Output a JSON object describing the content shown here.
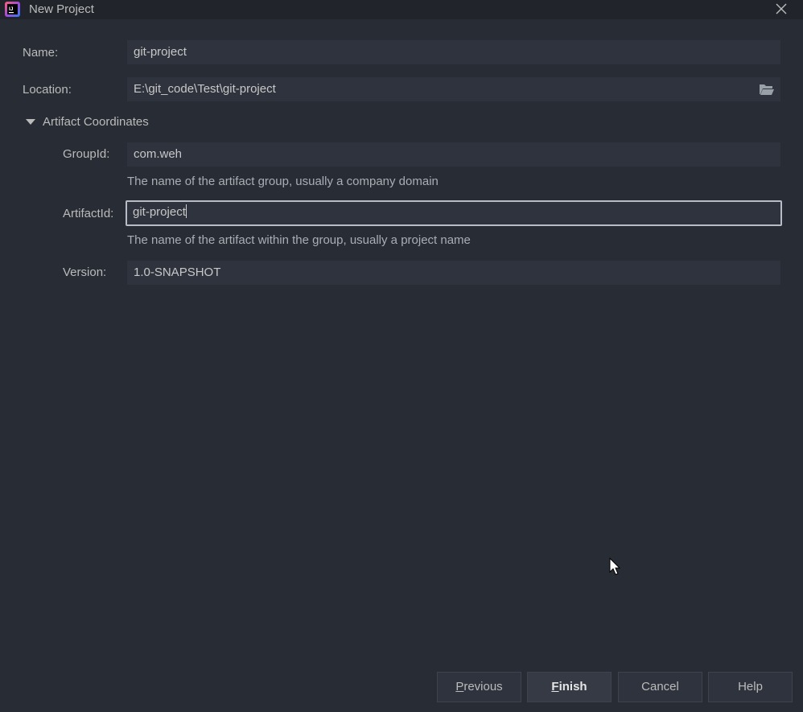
{
  "window": {
    "title": "New Project",
    "icon": "intellij-idea-icon"
  },
  "form": {
    "name": {
      "label": "Name:",
      "value": "git-project"
    },
    "location": {
      "label": "Location:",
      "value": "E:\\git_code\\Test\\git-project",
      "browse_icon": "folder-open-icon"
    },
    "section": {
      "label": "Artifact Coordinates",
      "expanded": true
    },
    "group_id": {
      "label": "GroupId:",
      "value": "com.weh",
      "hint": "The name of the artifact group, usually a company domain"
    },
    "artifact_id": {
      "label": "ArtifactId:",
      "value": "git-project",
      "hint": "The name of the artifact within the group, usually a project name",
      "focused": true
    },
    "version": {
      "label": "Version:",
      "value": "1.0-SNAPSHOT"
    }
  },
  "buttons": {
    "previous": {
      "first": "P",
      "rest": "revious"
    },
    "finish": {
      "first": "F",
      "rest": "inish"
    },
    "cancel": "Cancel",
    "help": "Help"
  }
}
